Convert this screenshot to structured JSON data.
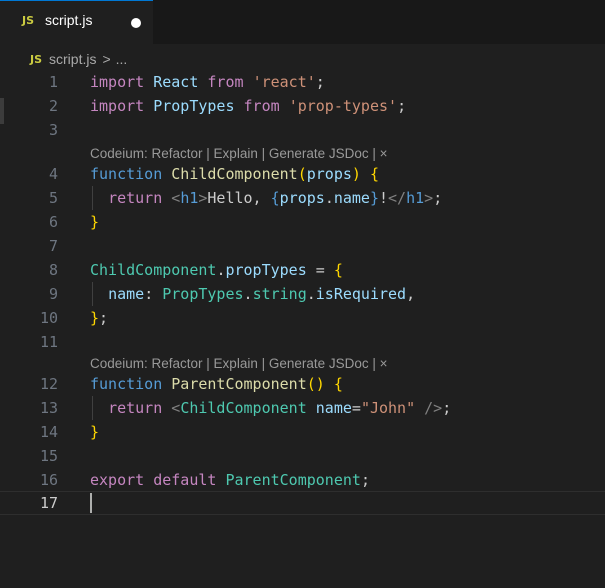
{
  "tab": {
    "icon": "JS",
    "title": "script.js",
    "modified_indicator": "unsaved-dot"
  },
  "breadcrumb": {
    "icon": "JS",
    "file": "script.js",
    "separator": ">",
    "more": "..."
  },
  "codelens": {
    "text_1": "Codeium: Refactor | Explain | Generate JSDoc | ×",
    "text_2": "Codeium: Refactor | Explain | Generate JSDoc | ×"
  },
  "lines": [
    {
      "n": "1"
    },
    {
      "n": "2"
    },
    {
      "n": "3"
    },
    {
      "n": "4"
    },
    {
      "n": "5"
    },
    {
      "n": "6"
    },
    {
      "n": "7"
    },
    {
      "n": "8"
    },
    {
      "n": "9"
    },
    {
      "n": "10"
    },
    {
      "n": "11"
    },
    {
      "n": "12"
    },
    {
      "n": "13"
    },
    {
      "n": "14"
    },
    {
      "n": "15"
    },
    {
      "n": "16"
    },
    {
      "n": "17"
    }
  ],
  "code": {
    "l1": {
      "kw": "import",
      "id": "React",
      "kw2": "from",
      "str": "'react'",
      "end": ";"
    },
    "l2": {
      "kw": "import",
      "id": "PropTypes",
      "kw2": "from",
      "str": "'prop-types'",
      "end": ";"
    },
    "l4": {
      "kw": "function",
      "fn": "ChildComponent",
      "open": "(",
      "param": "props",
      "close": ")",
      "brace": "{"
    },
    "l5": {
      "kw": "return",
      "lt": "<",
      "tag": "h1",
      "gt": ">",
      "text": "Hello, ",
      "ob": "{",
      "obj": "props",
      "dot": ".",
      "prop": "name",
      "cb": "}",
      "bang": "!",
      "lt2": "</",
      "tag2": "h1",
      "gt2": ">",
      "end": ";"
    },
    "l6": {
      "brace": "}"
    },
    "l8": {
      "obj": "ChildComponent",
      "dot": ".",
      "prop": "propTypes",
      "eq": " = ",
      "brace": "{"
    },
    "l9": {
      "key": "name",
      "colon": ": ",
      "obj": "PropTypes",
      "dot1": ".",
      "p1": "string",
      "dot2": ".",
      "p2": "isRequired",
      "comma": ","
    },
    "l10": {
      "brace": "}",
      "end": ";"
    },
    "l12": {
      "kw": "function",
      "fn": "ParentComponent",
      "parens": "()",
      "brace": "{"
    },
    "l13": {
      "kw": "return",
      "lt": "<",
      "tag": "ChildComponent",
      "attr": "name",
      "eq": "=",
      "str": "\"John\"",
      "close": " />",
      "end": ";"
    },
    "l14": {
      "brace": "}"
    },
    "l16": {
      "kw": "export",
      "kw2": "default",
      "id": "ParentComponent",
      "end": ";"
    }
  }
}
